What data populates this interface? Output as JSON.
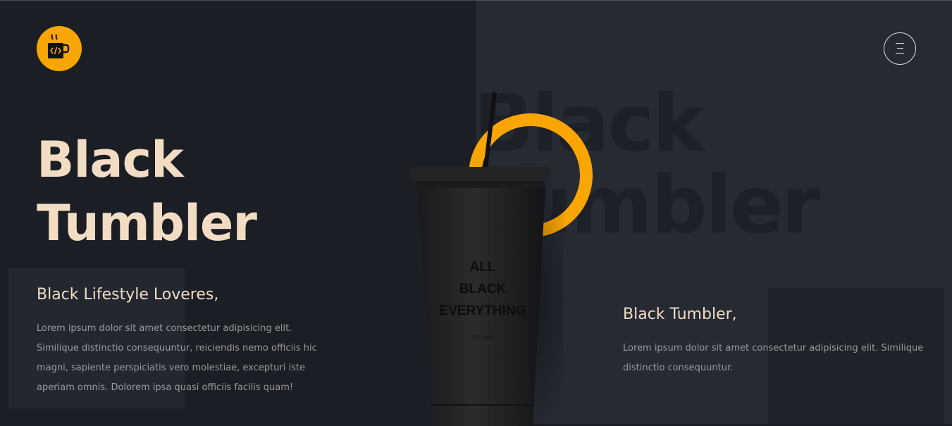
{
  "header": {
    "logo_icon": "coffee-code-icon",
    "menu_icon": "hamburger-menu-icon"
  },
  "hero": {
    "title_line1": "Black",
    "title_line2": "Tumbler",
    "bg_title_line1": "Black",
    "bg_title_line2": "Tumbler"
  },
  "left_section": {
    "heading": "Black Lifestyle Loveres,",
    "text": "Lorem ipsum dolor sit amet consectetur adipisicing elit. Similique distinctio consequuntur, reiciendis nemo officiis hic magni, sapiente perspiciatis vero molestiae, excepturi iste aperiam omnis. Dolorem ipsa quasi officiis facilis quam!"
  },
  "right_section": {
    "heading": "Black Tumbler,",
    "text": "Lorem ipsum dolor sit amet consectetur adipisicing elit. Similique distinctio consequuntur."
  },
  "product": {
    "print_line1": "ALL",
    "print_line2": "BLACK",
    "print_line3": "EVERYTHING",
    "print_small": "EST 2019"
  },
  "colors": {
    "accent": "#f9a602",
    "title": "#f2dcc4",
    "background_left": "#1b1e24",
    "background_right": "#262a33"
  }
}
